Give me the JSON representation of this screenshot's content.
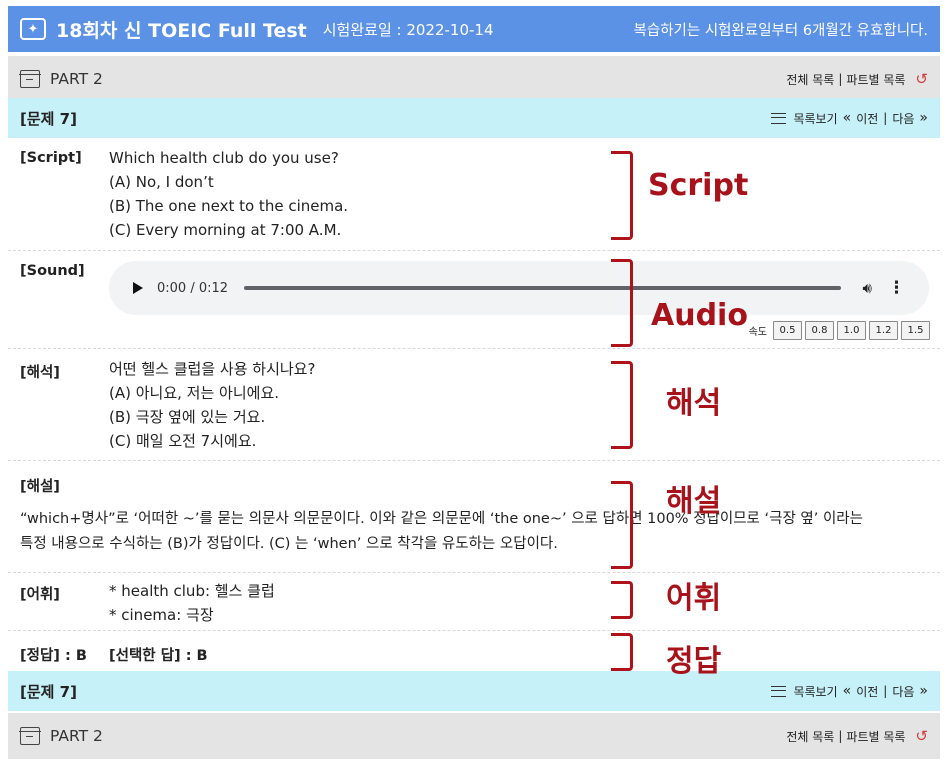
{
  "header": {
    "title": "18회차 신 TOEIC Full Test",
    "completed": "시험완료일 : 2022-10-14",
    "notice": "복습하기는 시험완료일부터 6개월간 유효합니다."
  },
  "part_bar": {
    "label": "PART 2",
    "all_list": "전체 목록",
    "separator": "|",
    "part_list": "파트별 목록"
  },
  "question_bar": {
    "label": "[문제 7]",
    "list_view": "목록보기",
    "prev": "이전",
    "separator": "|",
    "next": "다음"
  },
  "script": {
    "label": "[Script]",
    "lines": [
      "Which health club do you use?",
      "(A) No, I don’t",
      "(B) The one next to the cinema.",
      "(C) Every morning at 7:00 A.M."
    ]
  },
  "sound": {
    "label": "[Sound]",
    "time": "0:00 / 0:12",
    "speed_label": "속도",
    "speeds": [
      "0.5",
      "0.8",
      "1.0",
      "1.2",
      "1.5"
    ]
  },
  "translation": {
    "label": "[해석]",
    "lines": [
      "어떤 헬스 클럽을 사용 하시나요?",
      "(A) 아니요, 저는 아니에요.",
      "(B) 극장 옆에 있는 거요.",
      "(C) 매일 오전 7시에요."
    ]
  },
  "explanation": {
    "label": "[해설]",
    "lines": [
      "“which+명사”로 ‘어떠한 ~’를 묻는 의문사 의문문이다. 이와 같은 의문문에 ‘the one~’ 으로 답하면 100% 정답이므로 ‘극장 옆’ 이라는",
      "특정 내용으로 수식하는 (B)가 정답이다. (C) 는 ‘when’ 으로 착각을 유도하는 오답이다."
    ]
  },
  "vocab": {
    "label": "[어휘]",
    "lines": [
      "* health club: 헬스 클럽",
      "* cinema: 극장"
    ]
  },
  "answer": {
    "correct": "[정답] : B",
    "selected": "[선택한 답] : B"
  },
  "annotations": {
    "script": "Script",
    "audio": "Audio",
    "translation": "해석",
    "explanation": "해설",
    "vocab": "어휘",
    "answer": "정답"
  },
  "colors": {
    "header_bg": "#5b92e5",
    "part_bg": "#e4e4e4",
    "question_bg": "#c7f1f8",
    "annotation": "#a8121a",
    "undo_icon": "#d63b3b"
  }
}
